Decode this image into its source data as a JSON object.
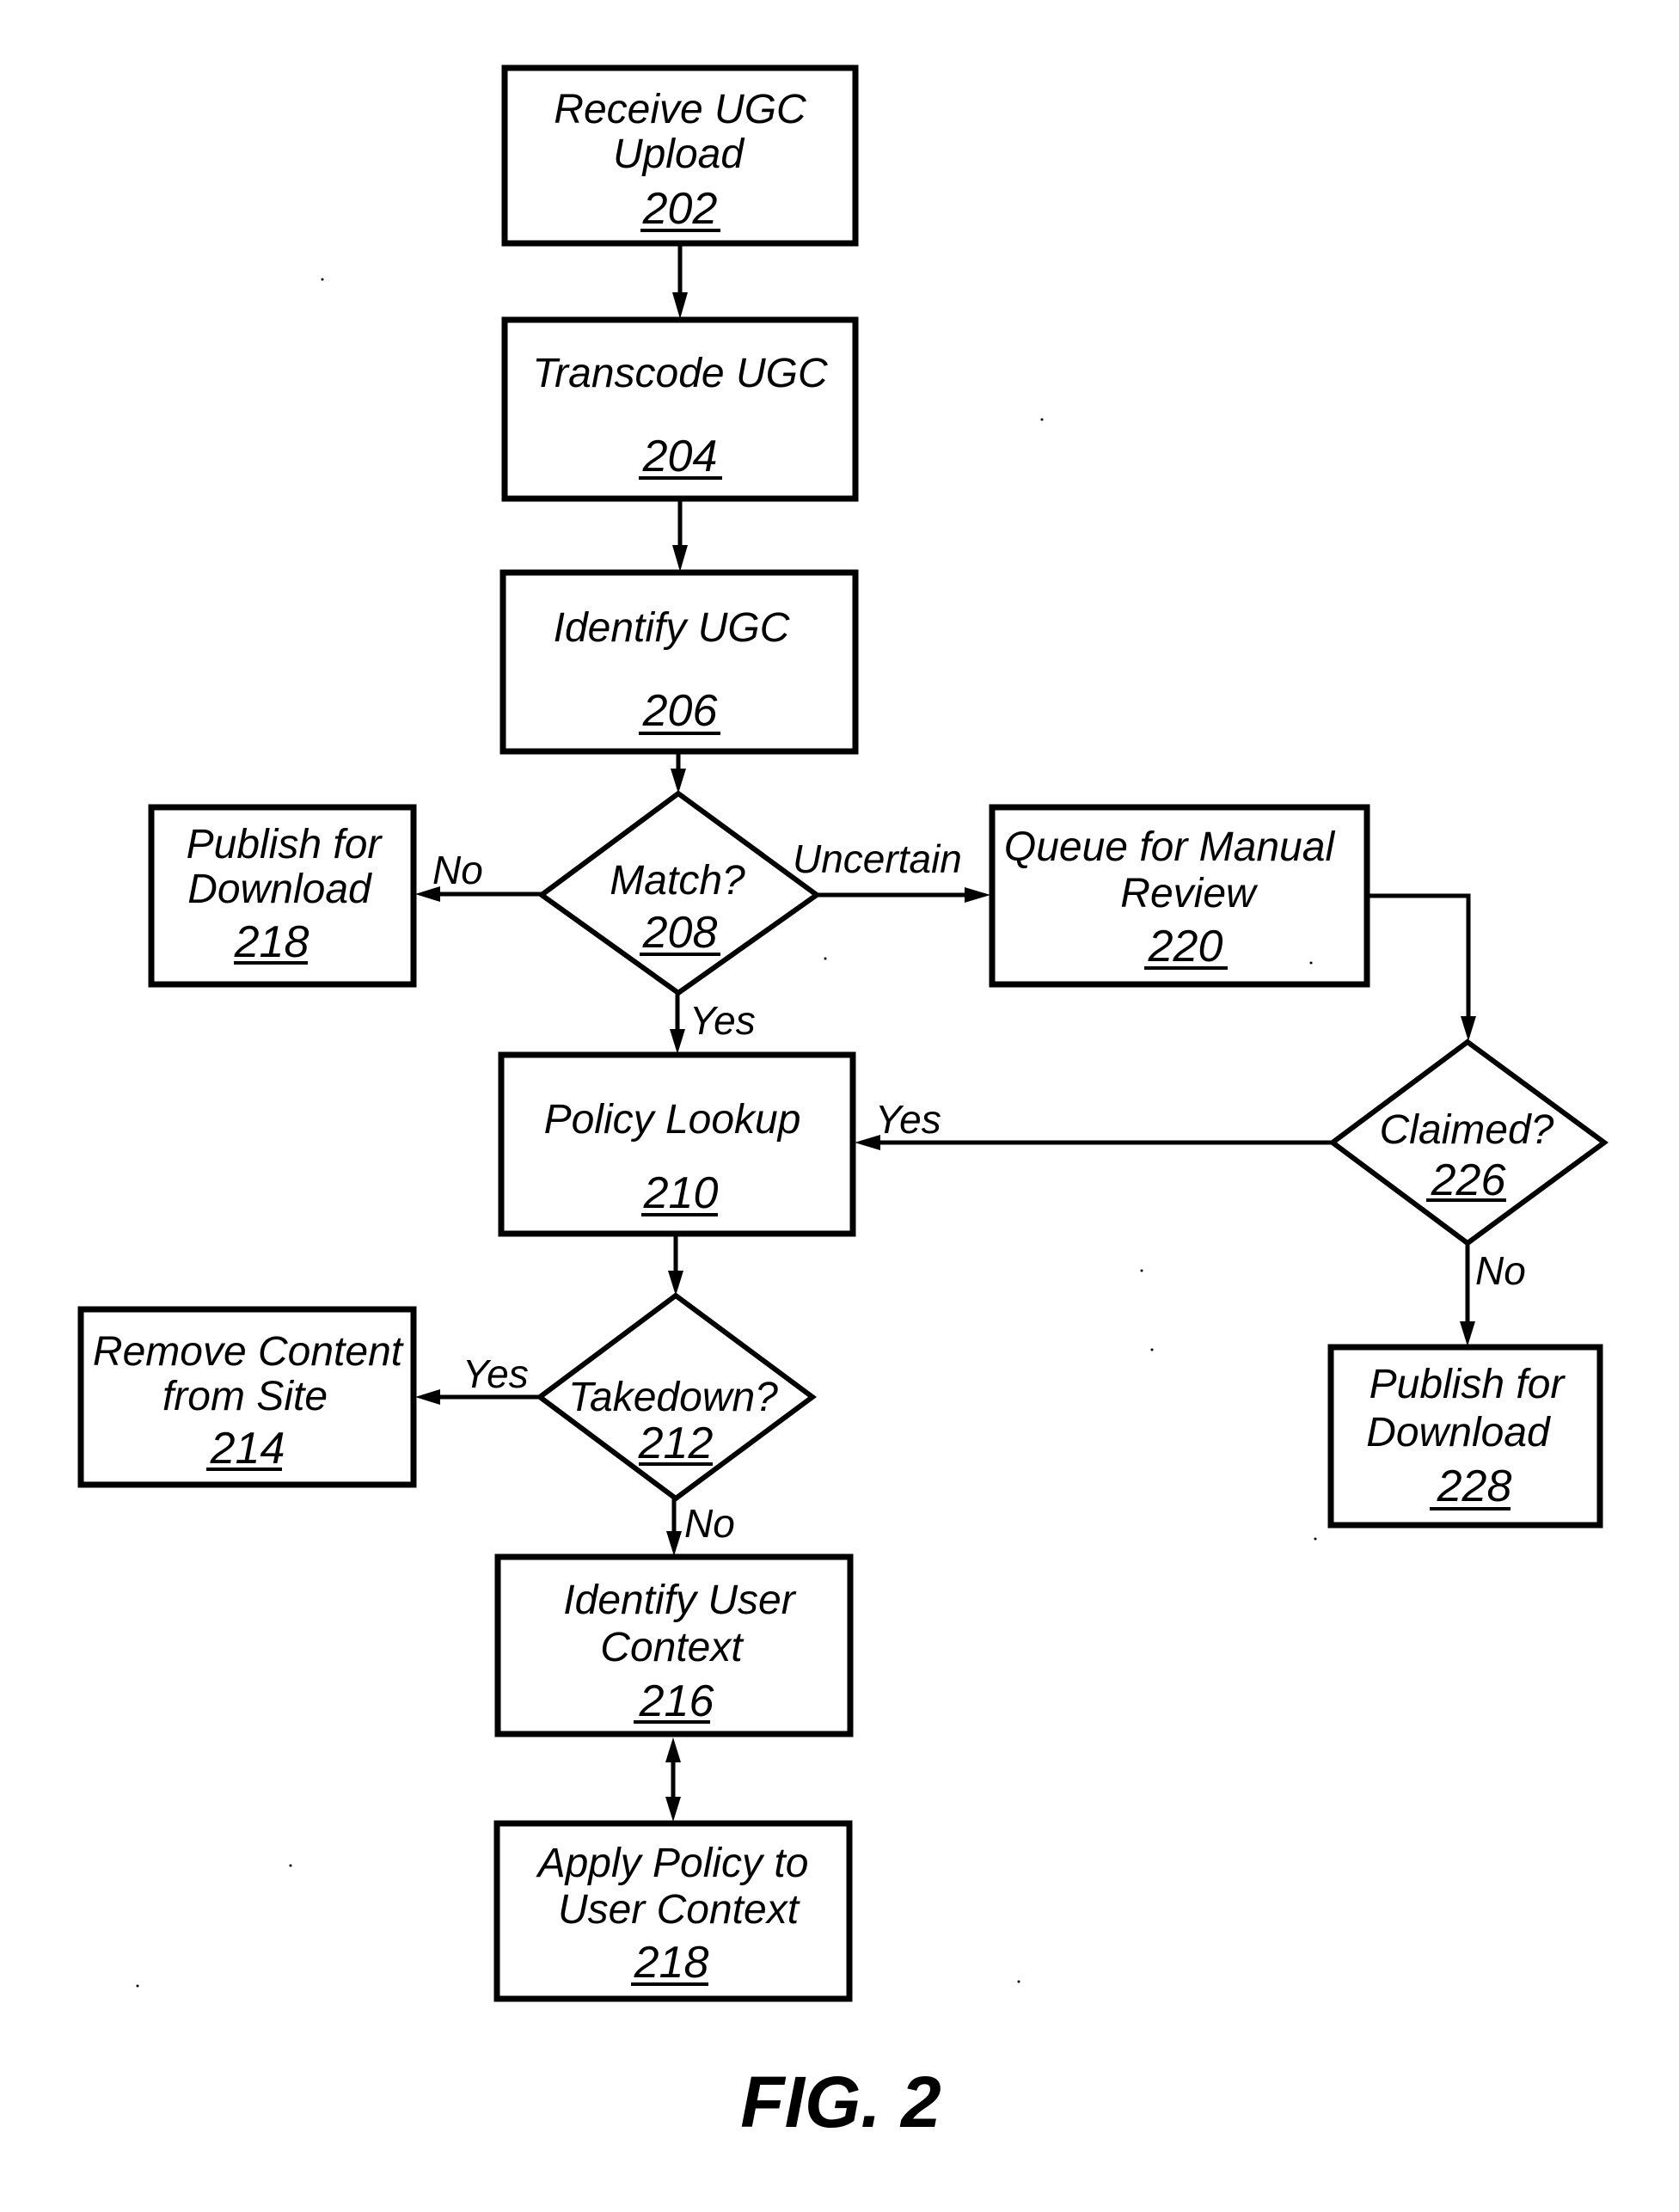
{
  "figure": {
    "caption": "FIG. 2",
    "nodes": {
      "n202": {
        "type": "process",
        "lines": [
          "Receive UGC",
          "Upload"
        ],
        "ref": "202"
      },
      "n204": {
        "type": "process",
        "lines": [
          "Transcode UGC"
        ],
        "ref": "204"
      },
      "n206": {
        "type": "process",
        "lines": [
          "Identify UGC"
        ],
        "ref": "206"
      },
      "n208": {
        "type": "decision",
        "lines": [
          "Match?"
        ],
        "ref": "208"
      },
      "n218a": {
        "type": "process",
        "lines": [
          "Publish for",
          "Download"
        ],
        "ref": "218"
      },
      "n220": {
        "type": "process",
        "lines": [
          "Queue for Manual",
          "Review"
        ],
        "ref": "220"
      },
      "n210": {
        "type": "process",
        "lines": [
          "Policy Lookup"
        ],
        "ref": "210"
      },
      "n226": {
        "type": "decision",
        "lines": [
          "Claimed?"
        ],
        "ref": "226"
      },
      "n212": {
        "type": "decision",
        "lines": [
          "Takedown?"
        ],
        "ref": "212"
      },
      "n214": {
        "type": "process",
        "lines": [
          "Remove Content",
          "from Site"
        ],
        "ref": "214"
      },
      "n228": {
        "type": "process",
        "lines": [
          "Publish for",
          "Download"
        ],
        "ref": "228"
      },
      "n216": {
        "type": "process",
        "lines": [
          "Identify User",
          "Context"
        ],
        "ref": "216"
      },
      "n218b": {
        "type": "process",
        "lines": [
          "Apply Policy to",
          "User Context"
        ],
        "ref": "218"
      }
    },
    "edges": [
      {
        "from": "202",
        "to": "204",
        "label": ""
      },
      {
        "from": "204",
        "to": "206",
        "label": ""
      },
      {
        "from": "206",
        "to": "208",
        "label": ""
      },
      {
        "from": "208",
        "to": "218",
        "label": "No"
      },
      {
        "from": "208",
        "to": "220",
        "label": "Uncertain"
      },
      {
        "from": "208",
        "to": "210",
        "label": "Yes"
      },
      {
        "from": "220",
        "to": "226",
        "label": ""
      },
      {
        "from": "226",
        "to": "210",
        "label": "Yes"
      },
      {
        "from": "226",
        "to": "228",
        "label": "No"
      },
      {
        "from": "210",
        "to": "212",
        "label": ""
      },
      {
        "from": "212",
        "to": "214",
        "label": "Yes"
      },
      {
        "from": "212",
        "to": "216",
        "label": "No"
      },
      {
        "from": "216",
        "to": "218",
        "label": "",
        "bidirectional": true
      }
    ],
    "edge_labels": {
      "match_no": "No",
      "match_uncertain": "Uncertain",
      "match_yes": "Yes",
      "claimed_yes": "Yes",
      "claimed_no": "No",
      "takedown_yes": "Yes",
      "takedown_no": "No"
    }
  }
}
